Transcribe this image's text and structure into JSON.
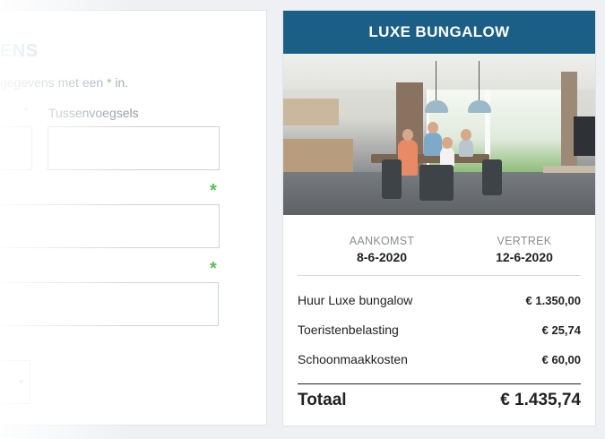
{
  "form": {
    "heading": "ENS",
    "intro_before": "gegevens met een ",
    "intro_req": "*",
    "intro_after": " in.",
    "star": "*",
    "tussenvoegsels_label": "Tussenvoegsels",
    "required_mark": "*",
    "select_arrow": "▾"
  },
  "card": {
    "title": "LUXE BUNGALOW",
    "photo_alt": "Bungalow interior",
    "arrival_label": "AANKOMST",
    "arrival_date": "8-6-2020",
    "departure_label": "VERTREK",
    "departure_date": "12-6-2020",
    "items": [
      {
        "label": "Huur Luxe bungalow",
        "amount": "€ 1.350,00"
      },
      {
        "label": "Toeristenbelasting",
        "amount": "€ 25,74"
      },
      {
        "label": "Schoonmaakkosten",
        "amount": "€ 60,00"
      }
    ],
    "total_label": "Totaal",
    "total_amount": "€ 1.435,74"
  },
  "colors": {
    "header_bg": "#1c5f86",
    "required_green": "#5bbd5b"
  }
}
